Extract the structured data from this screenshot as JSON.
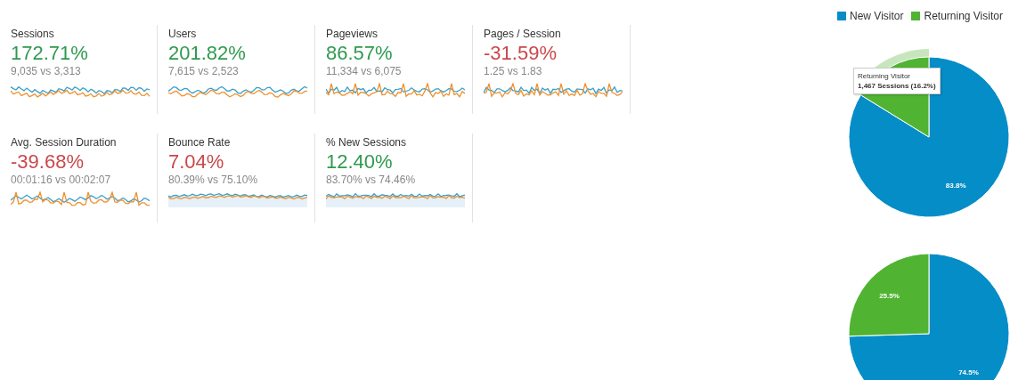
{
  "metrics": [
    {
      "title": "Sessions",
      "change": "172.71%",
      "color": "#2e9a4e",
      "comparison": "9,035 vs 3,313",
      "area_fill": false
    },
    {
      "title": "Users",
      "change": "201.82%",
      "color": "#2e9a4e",
      "comparison": "7,615 vs 2,523",
      "area_fill": false
    },
    {
      "title": "Pageviews",
      "change": "86.57%",
      "color": "#2e9a4e",
      "comparison": "11,334 vs 6,075",
      "area_fill": false
    },
    {
      "title": "Pages / Session",
      "change": "-31.59%",
      "color": "#c9484a",
      "comparison": "1.25 vs 1.83",
      "area_fill": false
    },
    {
      "title": "Avg. Session Duration",
      "change": "-39.68%",
      "color": "#c9484a",
      "comparison": "00:01:16 vs 00:02:07",
      "area_fill": false
    },
    {
      "title": "Bounce Rate",
      "change": "7.04%",
      "color": "#c9484a",
      "comparison": "80.39% vs 75.10%",
      "area_fill": true
    },
    {
      "title": "% New Sessions",
      "change": "12.40%",
      "color": "#2e9a4e",
      "comparison": "83.70% vs 74.46%",
      "area_fill": true
    }
  ],
  "legend": [
    {
      "color": "#058dc7"
    },
    {
      "color": "#50b432"
    }
  ],
  "pies": [
    {
      "chart_data": {
        "type": "pie",
        "categories": [
          "New Visitor",
          "Returning Visitor"
        ],
        "values": [
          83.8,
          16.2
        ],
        "value_labels": [
          "83.8%",
          null
        ]
      },
      "slices": [
        {
          "highlighted": false
        },
        {
          "highlighted": true
        }
      ],
      "tooltip": {
        "title": "Returning Visitor",
        "value": "1,467 Sessions (16.2%)"
      }
    },
    {
      "chart_data": {
        "type": "pie",
        "values": [
          74.5,
          25.5
        ],
        "value_labels": [
          "74.5%",
          "25.5%"
        ]
      }
    }
  ]
}
